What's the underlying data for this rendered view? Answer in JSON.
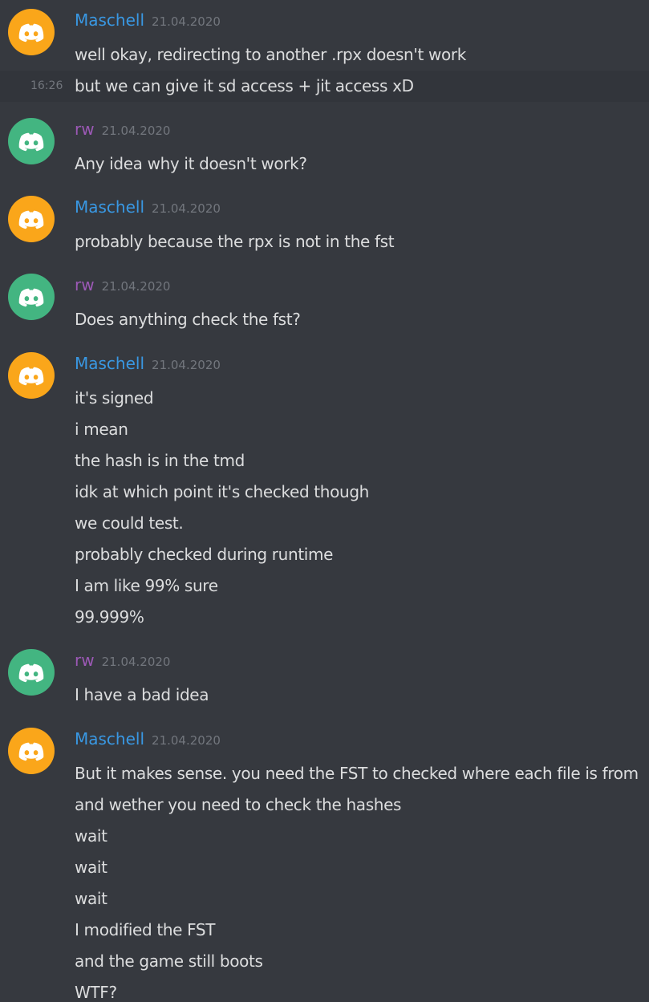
{
  "colors": {
    "background": "#36393f",
    "message_text": "#dcddde",
    "timestamp": "#72767d",
    "hover_row": "#32353b",
    "maschell_name": "#3998e3",
    "rw_name": "#9c59b6",
    "maschell_avatar": "#faa61a",
    "rw_avatar": "#43b581"
  },
  "icons": {
    "avatar_icon": "discord-default-avatar-icon"
  },
  "groups": [
    {
      "username": "Maschell",
      "date": "21.04.2020",
      "avatar_color": "#faa61a",
      "name_color": "#3998e3",
      "messages": [
        "well okay, redirecting to another .rpx doesn't work"
      ],
      "hover_message": {
        "time": "16:26",
        "text": "but we can give it sd access + jit access xD"
      }
    },
    {
      "username": "rw",
      "date": "21.04.2020",
      "avatar_color": "#43b581",
      "name_color": "#9c59b6",
      "messages": [
        "Any idea why it doesn't work?"
      ]
    },
    {
      "username": "Maschell",
      "date": "21.04.2020",
      "avatar_color": "#faa61a",
      "name_color": "#3998e3",
      "messages": [
        "probably because the rpx is not in the fst"
      ]
    },
    {
      "username": "rw",
      "date": "21.04.2020",
      "avatar_color": "#43b581",
      "name_color": "#9c59b6",
      "messages": [
        "Does anything check the fst?"
      ]
    },
    {
      "username": "Maschell",
      "date": "21.04.2020",
      "avatar_color": "#faa61a",
      "name_color": "#3998e3",
      "messages": [
        "it's signed",
        "i mean",
        "the hash is in the tmd",
        "idk at which point it's checked though",
        "we could test.",
        "probably checked during runtime",
        "I am like 99% sure",
        "99.999%"
      ]
    },
    {
      "username": "rw",
      "date": "21.04.2020",
      "avatar_color": "#43b581",
      "name_color": "#9c59b6",
      "messages": [
        "I have a bad idea"
      ]
    },
    {
      "username": "Maschell",
      "date": "21.04.2020",
      "avatar_color": "#faa61a",
      "name_color": "#3998e3",
      "messages": [
        "But it makes sense. you need the FST to checked where each file is from",
        "and wether you need to check the hashes",
        "wait",
        "wait",
        "wait",
        "I modified the FST",
        "and the game still boots",
        "WTF?"
      ]
    }
  ]
}
